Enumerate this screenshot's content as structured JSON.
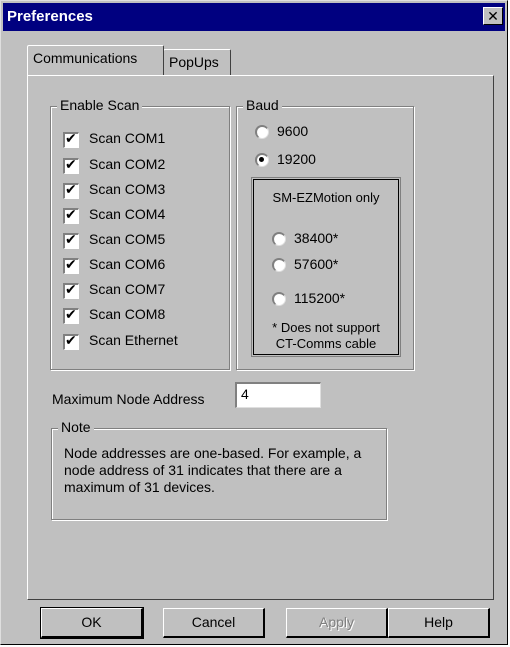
{
  "window": {
    "title": "Preferences",
    "close_glyph": "✕"
  },
  "tabs": [
    {
      "label": "Communications"
    },
    {
      "label": "PopUps"
    }
  ],
  "enable_scan": {
    "title": "Enable Scan",
    "check_glyph": "✔",
    "items": [
      {
        "label": "Scan COM1",
        "checked": true
      },
      {
        "label": "Scan COM2",
        "checked": true
      },
      {
        "label": "Scan COM3",
        "checked": true
      },
      {
        "label": "Scan COM4",
        "checked": true
      },
      {
        "label": "Scan COM5",
        "checked": true
      },
      {
        "label": "Scan COM6",
        "checked": true
      },
      {
        "label": "Scan COM7",
        "checked": true
      },
      {
        "label": "Scan COM8",
        "checked": true
      },
      {
        "label": "Scan Ethernet",
        "checked": true
      }
    ]
  },
  "baud": {
    "title": "Baud",
    "options": [
      {
        "label": "9600",
        "selected": false
      },
      {
        "label": "19200",
        "selected": true
      }
    ],
    "ezmotion": {
      "title": "SM-EZMotion only",
      "options": [
        {
          "label": "38400*",
          "selected": false
        },
        {
          "label": "57600*",
          "selected": false
        },
        {
          "label": "115200*",
          "selected": false
        }
      ],
      "footnote_line1": "* Does not support",
      "footnote_line2": "CT-Comms cable"
    }
  },
  "max_node": {
    "label": "Maximum Node Address",
    "value": "4"
  },
  "note": {
    "title": "Note",
    "text": "Node addresses are one-based.  For example, a node address of 31 indicates that there are a maximum of 31 devices."
  },
  "buttons": {
    "ok": "OK",
    "cancel": "Cancel",
    "apply": "Apply",
    "help": "Help"
  },
  "colors": {
    "titlebar": "#000080",
    "face": "#c0c0c0",
    "disabled_text": "#808080"
  }
}
